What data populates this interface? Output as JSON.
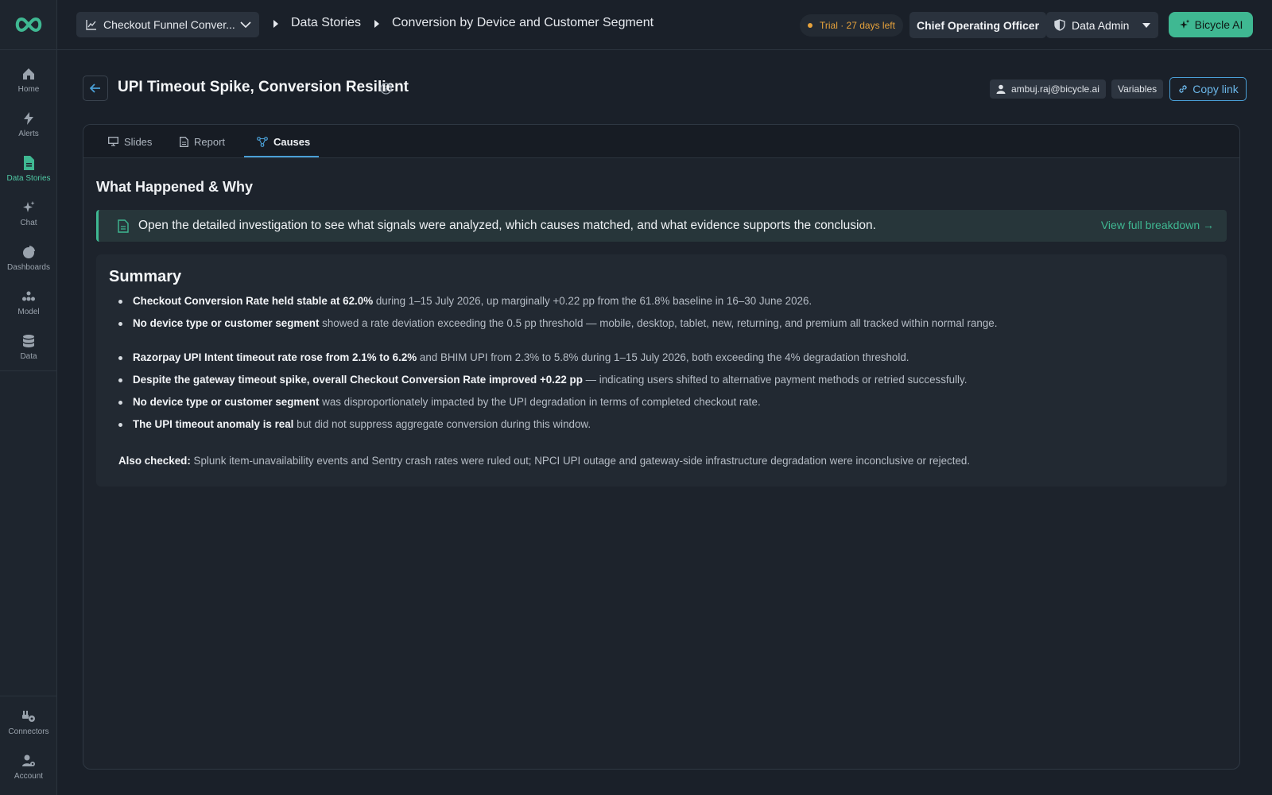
{
  "sidebar": {
    "items": [
      {
        "label": "Home",
        "icon": "home-icon"
      },
      {
        "label": "Alerts",
        "icon": "bolt-icon"
      },
      {
        "label": "Data Stories",
        "icon": "document-icon",
        "active": true
      },
      {
        "label": "Chat",
        "icon": "sparkle-icon"
      },
      {
        "label": "Dashboards",
        "icon": "pie-chart-icon"
      },
      {
        "label": "Model",
        "icon": "model-icon"
      },
      {
        "label": "Data",
        "icon": "database-icon"
      }
    ],
    "bottom": [
      {
        "label": "Connectors",
        "icon": "connector-icon"
      },
      {
        "label": "Account",
        "icon": "account-settings-icon"
      }
    ]
  },
  "topbar": {
    "dashboard": "Checkout Funnel Conver...",
    "breadcrumb": [
      "Data Stories",
      "Conversion by Device and Customer Segment"
    ],
    "trial": "Trial · 27 days left",
    "role": "Chief Operating Officer",
    "admin": "Data Admin",
    "ai_button": "Bicycle AI"
  },
  "header": {
    "title": "UPI Timeout Spike, Conversion Resilient",
    "user": "ambuj.raj@bicycle.ai",
    "variables": "Variables",
    "copy_link": "Copy link"
  },
  "tabs": [
    {
      "label": "Slides"
    },
    {
      "label": "Report"
    },
    {
      "label": "Causes",
      "active": true
    }
  ],
  "causes": {
    "heading": "What Happened & Why",
    "banner_text": "Open the detailed investigation to see what signals were analyzed, which causes matched, and what evidence supports the conclusion.",
    "banner_link": "View full breakdown →",
    "summary_title": "Summary",
    "bullets": [
      {
        "bold": "Checkout Conversion Rate held stable at 62.0%",
        "rest": " during 1–15 July 2026, up marginally +0.22 pp from the 61.8% baseline in 16–30 June 2026."
      },
      {
        "bold": "No device type or customer segment",
        "rest": " showed a rate deviation exceeding the 0.5 pp threshold — mobile, desktop, tablet, new, returning, and premium all tracked within normal range."
      },
      {
        "bold": "Razorpay UPI Intent timeout rate rose from 2.1% to 6.2%",
        "rest": " and BHIM UPI from 2.3% to 5.8% during 1–15 July 2026, both exceeding the 4% degradation threshold."
      },
      {
        "bold": "Despite the gateway timeout spike, overall Checkout Conversion Rate improved +0.22 pp",
        "rest": " — indicating users shifted to alternative payment methods or retried successfully."
      },
      {
        "bold": "No device type or customer segment",
        "rest": " was disproportionately impacted by the UPI degradation in terms of completed checkout rate."
      },
      {
        "bold": "The UPI timeout anomaly is real",
        "rest": " but did not suppress aggregate conversion during this window."
      }
    ],
    "also_bold": "Also checked:",
    "also_rest": " Splunk item-unavailability events and Sentry crash rates were ruled out; NPCI UPI outage and gateway-side infrastructure degradation were inconclusive or rejected."
  },
  "colors": {
    "accent": "#3fb892",
    "link": "#4a9fd6",
    "warning": "#e6a23c",
    "background": "#1a2029"
  }
}
